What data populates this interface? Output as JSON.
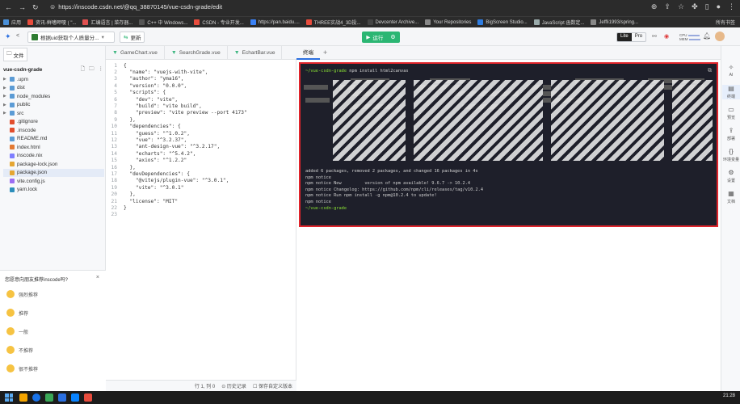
{
  "browser": {
    "url": "https://inscode.csdn.net/@qq_38870145/vue-csdn-grade/edit",
    "bookmarks": [
      {
        "label": "应用",
        "color": "#4a90d9"
      },
      {
        "label": "资讯-鲜嗜呷嗄 ( \"...",
        "color": "#e84c3d"
      },
      {
        "label": "汇编语言 | 菜存器...",
        "color": "#e05050"
      },
      {
        "label": "C++ 中 Windows...",
        "color": "#555"
      },
      {
        "label": "CSDN - 专业开发...",
        "color": "#e84c3d"
      },
      {
        "label": "https://pan.baidu....",
        "color": "#3b82f6"
      },
      {
        "label": "THREE实战4_3D投...",
        "color": "#e84c3d"
      },
      {
        "label": "Devcenter Archive...",
        "color": "#444"
      },
      {
        "label": "Your Repositories",
        "color": "#888"
      },
      {
        "label": "BigScreen Studio...",
        "color": "#2f7de1"
      },
      {
        "label": "JavaScript 函数定...",
        "color": "#9aa"
      },
      {
        "label": "Jeffli1993/spring...",
        "color": "#888"
      }
    ],
    "all_bookmarks": "所有书签"
  },
  "toolbar": {
    "project_title": "根据uid获取个人质量分...",
    "update_label": "更新",
    "run_label": "运行",
    "lite_label": "Lite",
    "pro_label": "Pro",
    "cpu_label": "CPU",
    "mem_label": "MEM"
  },
  "sidebar": {
    "file_tab": "文件",
    "project_name": "vue-csdn-grade",
    "tree": [
      {
        "name": ".upm",
        "type": "folder",
        "color": "#5b9bd5"
      },
      {
        "name": "dist",
        "type": "folder",
        "color": "#5b9bd5"
      },
      {
        "name": "node_modules",
        "type": "folder",
        "color": "#5b9bd5"
      },
      {
        "name": "public",
        "type": "folder",
        "color": "#5b9bd5"
      },
      {
        "name": "src",
        "type": "folder",
        "color": "#5b9bd5"
      },
      {
        "name": ".gitignore",
        "type": "file",
        "color": "#e24d2c"
      },
      {
        "name": ".inscode",
        "type": "file",
        "color": "#e24d2c"
      },
      {
        "name": "README.md",
        "type": "file",
        "color": "#5b9bd5"
      },
      {
        "name": "index.html",
        "type": "file",
        "color": "#e37933"
      },
      {
        "name": "inscode.nix",
        "type": "file",
        "color": "#7e7eff"
      },
      {
        "name": "package-lock.json",
        "type": "file",
        "color": "#e5a633"
      },
      {
        "name": "package.json",
        "type": "file",
        "color": "#e5a633",
        "selected": true
      },
      {
        "name": "vite.config.js",
        "type": "file",
        "color": "#9b6df3"
      },
      {
        "name": "yarn.lock",
        "type": "file",
        "color": "#2c8ebb"
      }
    ]
  },
  "feedback": {
    "question": "您愿意向朋友推荐inscode吗?",
    "options": [
      "强烈推荐",
      "推荐",
      "一般",
      "不推荐",
      "很不推荐"
    ]
  },
  "editor": {
    "tabs": [
      "GameChart.vue",
      "SearchGrade.vue",
      "EchartBar.vue"
    ],
    "lines": [
      "{",
      "  \"name\": \"vuejs-with-vite\",",
      "  \"author\": \"yma16\",",
      "  \"version\": \"0.0.0\",",
      "  \"scripts\": {",
      "    \"dev\": \"vite\",",
      "    \"build\": \"vite build\",",
      "    \"preview\": \"vite preview --port 4173\"",
      "  },",
      "  \"dependencies\": {",
      "    \"guess\": \"^1.0.2\",",
      "    \"vue\": \"^3.2.37\",",
      "    \"ant-design-vue\": \"^3.2.17\",",
      "    \"echarts\": \"^5.4.2\",",
      "    \"axios\": \"^1.2.2\"",
      "  },",
      "  \"devDependencies\": {",
      "    \"@vitejs/plugin-vue\": \"^3.0.1\",",
      "    \"vite\": \"^3.0.1\"",
      "  },",
      "  \"license\": \"MIT\"",
      "}",
      ""
    ],
    "status_position": "行 1, 列 0",
    "status_history": "历史记录",
    "status_save": "保存自定义版本"
  },
  "terminal": {
    "tab": "终端",
    "prompt": "~/vue-csdn-grade",
    "command": "npm install html2canvas",
    "summary": "added 6 packages, removed 2 packages, and changed 16 packages in 4s",
    "npm_lines": [
      "npm notice",
      "npm notice New         version of npm available! 9.6.7 -> 10.2.4",
      "npm notice Changelog: https://github.com/npm/cli/releases/tag/v10.2.4",
      "npm notice Run npm install -g npm@10.2.4 to update!",
      "npm notice"
    ],
    "end_prompt": "~/vue-csdn-grade"
  },
  "rightrail": [
    {
      "label": "AI",
      "icon": "ai-icon"
    },
    {
      "label": "终端",
      "icon": "terminal-icon",
      "active": true
    },
    {
      "label": "预览",
      "icon": "preview-icon"
    },
    {
      "label": "部署",
      "icon": "deploy-icon"
    },
    {
      "label": "环境变量",
      "icon": "env-icon"
    },
    {
      "label": "设置",
      "icon": "settings-icon"
    },
    {
      "label": "文档",
      "icon": "doc-icon"
    }
  ],
  "taskbar": {
    "time": "21:28",
    "date": "2023/12/3"
  },
  "colors": {
    "run_green": "#2bb673",
    "terminal_border": "#e0242b",
    "terminal_bg": "#1e1f2a"
  }
}
